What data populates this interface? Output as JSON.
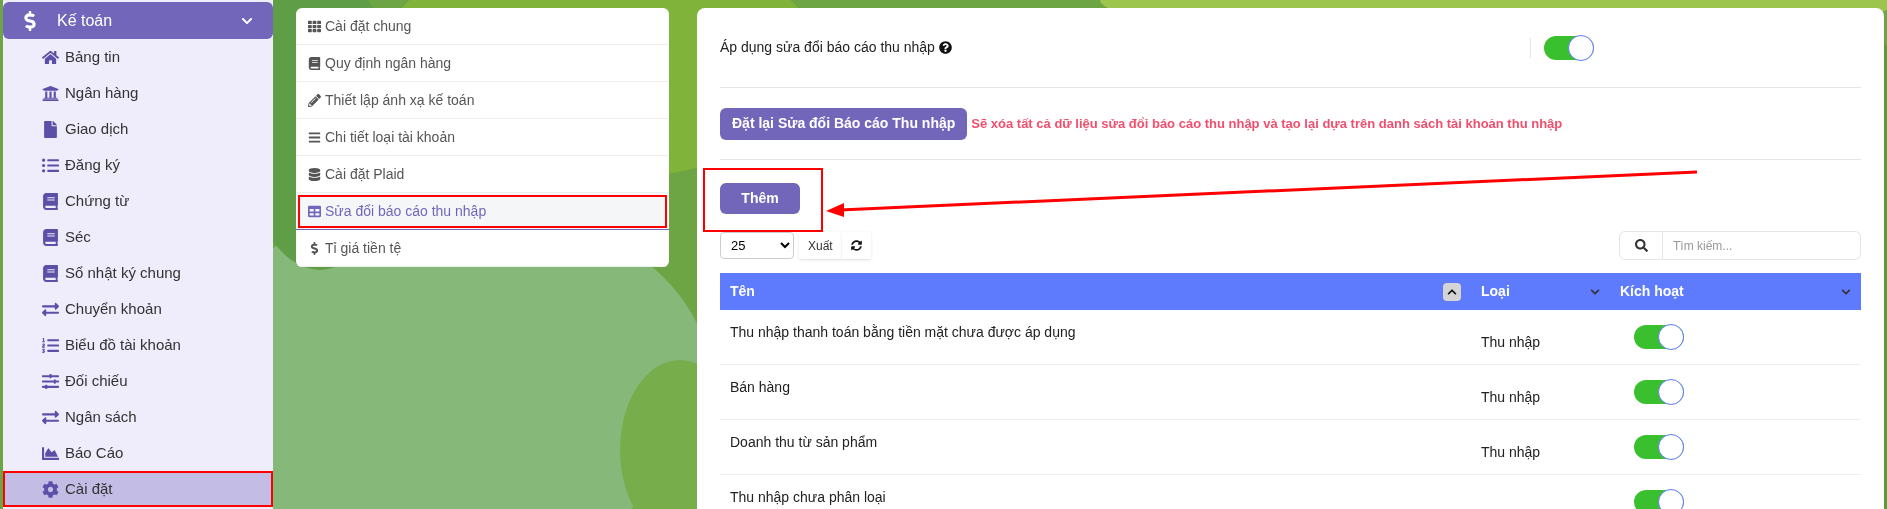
{
  "sidebar": {
    "header": {
      "label": "Kế toán",
      "expanded": true
    },
    "items": [
      {
        "label": "Bảng tin",
        "selected": false,
        "highlighted": false
      },
      {
        "label": "Ngân hàng",
        "selected": false,
        "highlighted": false
      },
      {
        "label": "Giao dịch",
        "selected": false,
        "highlighted": false
      },
      {
        "label": "Đăng ký",
        "selected": false,
        "highlighted": false
      },
      {
        "label": "Chứng từ",
        "selected": false,
        "highlighted": false
      },
      {
        "label": "Séc",
        "selected": false,
        "highlighted": false
      },
      {
        "label": "Sổ nhật ký chung",
        "selected": false,
        "highlighted": false
      },
      {
        "label": "Chuyển khoản",
        "selected": false,
        "highlighted": false
      },
      {
        "label": "Biểu đồ tài khoản",
        "selected": false,
        "highlighted": false
      },
      {
        "label": "Đối chiếu",
        "selected": false,
        "highlighted": false
      },
      {
        "label": "Ngân sách",
        "selected": false,
        "highlighted": false
      },
      {
        "label": "Báo Cáo",
        "selected": false,
        "highlighted": false
      },
      {
        "label": "Cài đặt",
        "selected": true,
        "highlighted": true
      }
    ]
  },
  "settings_menu": {
    "items": [
      {
        "label": "Cài đặt chung",
        "selected": false,
        "highlighted": false
      },
      {
        "label": "Quy định ngân hàng",
        "selected": false,
        "highlighted": false
      },
      {
        "label": "Thiết lập ánh xạ kế toán",
        "selected": false,
        "highlighted": false
      },
      {
        "label": "Chi tiết loại tài khoản",
        "selected": false,
        "highlighted": false
      },
      {
        "label": "Cài đặt Plaid",
        "selected": false,
        "highlighted": false
      },
      {
        "label": "Sửa đổi báo cáo thu nhập",
        "selected": true,
        "highlighted": true
      },
      {
        "label": "Tỉ giá tiền tệ",
        "selected": false,
        "highlighted": false
      }
    ]
  },
  "panel": {
    "apply_toggle": {
      "label": "Áp dụng sửa đổi báo cáo thu nhập",
      "on": true
    },
    "reset_button": "Đặt lại Sửa đổi Báo cáo Thu nhập",
    "reset_warning": "Sẽ xóa tất cả dữ liệu sửa đổi báo cáo thu nhập và tạo lại dựa trên danh sách tài khoản thu nhập",
    "add_button": {
      "label": "Thêm",
      "highlighted": true
    },
    "page_size": "25",
    "export_button": "Xuất",
    "search": {
      "placeholder": "Tìm kiếm..."
    },
    "table": {
      "columns": [
        {
          "label": "Tên",
          "sorted": true
        },
        {
          "label": "Loại",
          "sorted": false
        },
        {
          "label": "Kích hoạt",
          "sorted": false
        }
      ],
      "rows": [
        {
          "name": "Thu nhập thanh toán bằng tiền mặt chưa được áp dụng",
          "type": "Thu nhập",
          "active": true
        },
        {
          "name": "Bán hàng",
          "type": "Thu nhập",
          "active": true
        },
        {
          "name": "Doanh thu từ sản phẩm",
          "type": "Thu nhập",
          "active": true
        },
        {
          "name": "Thu nhập chưa phân loại",
          "active": true
        }
      ]
    }
  },
  "annotation_arrow": true
}
